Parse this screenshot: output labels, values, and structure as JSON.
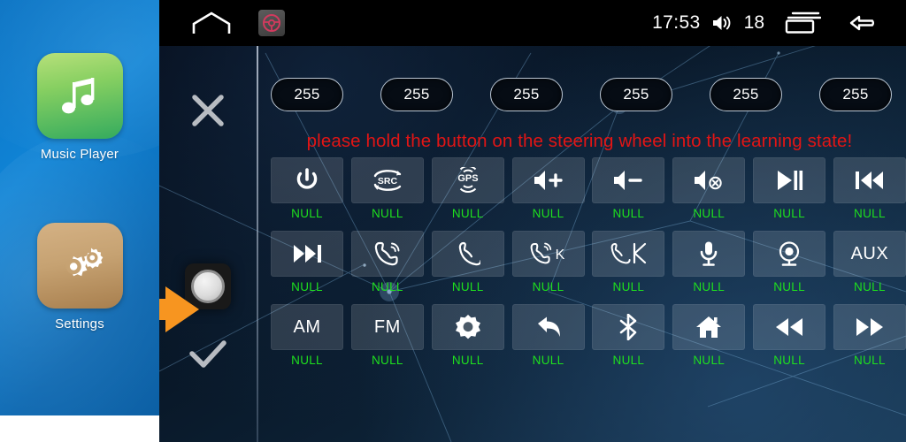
{
  "launcher": {
    "apps": [
      {
        "label": "Music Player",
        "icon": "music-note-icon"
      },
      {
        "label": "Settings",
        "icon": "gears-icon"
      }
    ]
  },
  "statusbar": {
    "home_icon": "home-icon",
    "app_icon": "steering-wheel-icon",
    "clock": "17:53",
    "volume_icon": "volume-icon",
    "volume_value": "18",
    "recents_icon": "recent-apps-icon",
    "back_icon": "back-arrow-icon"
  },
  "rail": {
    "cancel_icon": "x-icon",
    "knob_icon": "rotary-knob-icon",
    "confirm_icon": "check-icon",
    "pointer_icon": "orange-arrow-icon"
  },
  "values": {
    "pills": [
      "255",
      "255",
      "255",
      "255",
      "255",
      "255"
    ]
  },
  "warning": {
    "text": "please hold the button on the steering wheel into the learning state!",
    "color": "#e21515"
  },
  "grid": {
    "label_color": "#1ee01e",
    "rows": [
      [
        {
          "icon": "power-icon",
          "label": "NULL"
        },
        {
          "icon": "src-icon",
          "label": "NULL"
        },
        {
          "icon": "gps-icon",
          "label": "NULL"
        },
        {
          "icon": "volume-up-icon",
          "label": "NULL"
        },
        {
          "icon": "volume-down-icon",
          "label": "NULL"
        },
        {
          "icon": "mute-icon",
          "label": "NULL"
        },
        {
          "icon": "play-pause-icon",
          "label": "NULL"
        },
        {
          "icon": "previous-track-icon",
          "label": "NULL"
        }
      ],
      [
        {
          "icon": "next-track-icon",
          "label": "NULL"
        },
        {
          "icon": "phone-answer-icon",
          "label": "NULL"
        },
        {
          "icon": "phone-hangup-icon",
          "label": "NULL"
        },
        {
          "icon": "phone-answer-k-icon",
          "label": "NULL"
        },
        {
          "icon": "phone-reject-icon",
          "label": "NULL"
        },
        {
          "icon": "microphone-icon",
          "label": "NULL"
        },
        {
          "icon": "camera-icon",
          "label": "NULL"
        },
        {
          "icon": "aux-icon",
          "text": "AUX",
          "label": "NULL"
        }
      ],
      [
        {
          "icon": "am-icon",
          "text": "AM",
          "label": "NULL"
        },
        {
          "icon": "fm-icon",
          "text": "FM",
          "label": "NULL"
        },
        {
          "icon": "settings-gear-icon",
          "label": "NULL"
        },
        {
          "icon": "back-icon",
          "label": "NULL"
        },
        {
          "icon": "bluetooth-icon",
          "label": "NULL"
        },
        {
          "icon": "home-button-icon",
          "label": "NULL"
        },
        {
          "icon": "rewind-icon",
          "label": "NULL"
        },
        {
          "icon": "fast-forward-icon",
          "label": "NULL"
        }
      ]
    ]
  }
}
